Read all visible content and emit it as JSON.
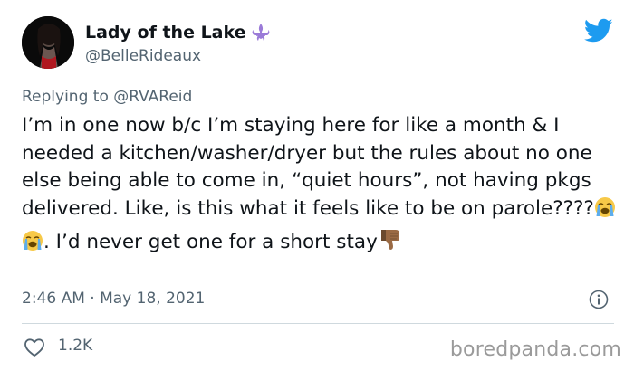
{
  "author": {
    "display_name": "Lady of the Lake",
    "handle": "@BelleRideaux",
    "name_emoji": "fleur-de-lis-icon"
  },
  "reply": {
    "prefix": "Replying to ",
    "mention": "@RVAReid"
  },
  "tweet": {
    "text_part1": "I’m in one now b/c I’m staying here for like a month & I needed a kitchen/washer/dryer but the rules about no one else being able to come in, “quiet hours”, not having pkgs delivered. Like, is this what it feels like to be on parole????",
    "text_part2": ". I’d never get one for a short stay",
    "emojis": [
      "loudly-crying-face-icon",
      "loudly-crying-face-icon",
      "thumbs-down-icon"
    ]
  },
  "meta": {
    "timestamp": "2:46 AM · May 18, 2021"
  },
  "engagement": {
    "likes": "1.2K"
  },
  "watermark": "boredpanda.com",
  "colors": {
    "twitter_blue": "#1d9bf0",
    "secondary_text": "#536471",
    "fleur_purple": "#9b7bd8"
  }
}
